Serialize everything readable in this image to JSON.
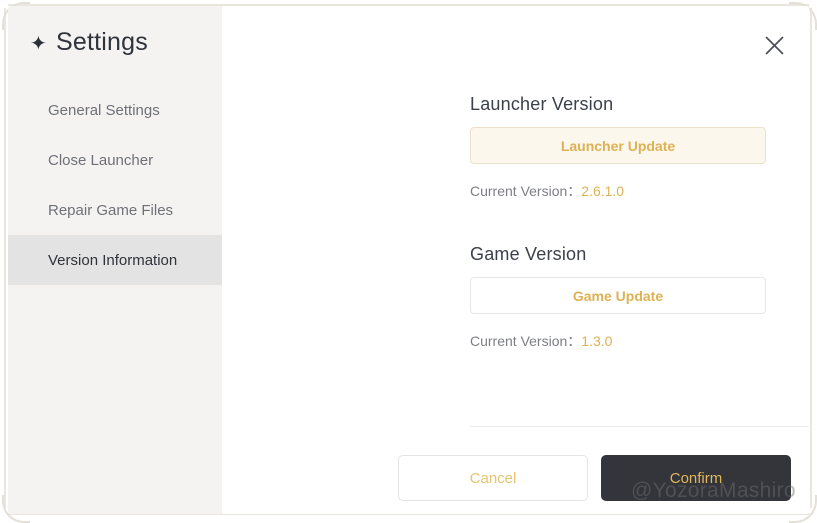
{
  "window": {
    "close_icon": "close-icon"
  },
  "sidebar": {
    "title": "Settings",
    "title_icon": "✦",
    "items": [
      {
        "label": "General Settings",
        "active": false
      },
      {
        "label": "Close Launcher",
        "active": false
      },
      {
        "label": "Repair Game Files",
        "active": false
      },
      {
        "label": "Version Information",
        "active": true
      }
    ]
  },
  "main": {
    "sections": [
      {
        "heading": "Launcher Version",
        "button_label": "Launcher Update",
        "version_label": "Current Version：",
        "version_value": "2.6.1.0"
      },
      {
        "heading": "Game Version",
        "button_label": "Game Update",
        "version_label": "Current Version：",
        "version_value": "1.3.0"
      }
    ]
  },
  "footer": {
    "cancel_label": "Cancel",
    "confirm_label": "Confirm"
  },
  "watermark": {
    "text": "@YozoraMashiro"
  },
  "colors": {
    "gold": "#ddb254",
    "sidebar_bg": "#f4f3f1",
    "active_bg": "#e3e3e3",
    "confirm_bg": "#33353b",
    "heading": "#3b404b",
    "muted_text": "#7d7f85",
    "cream_button_bg": "#fbf7ec",
    "frame_border": "#e8e6df"
  }
}
